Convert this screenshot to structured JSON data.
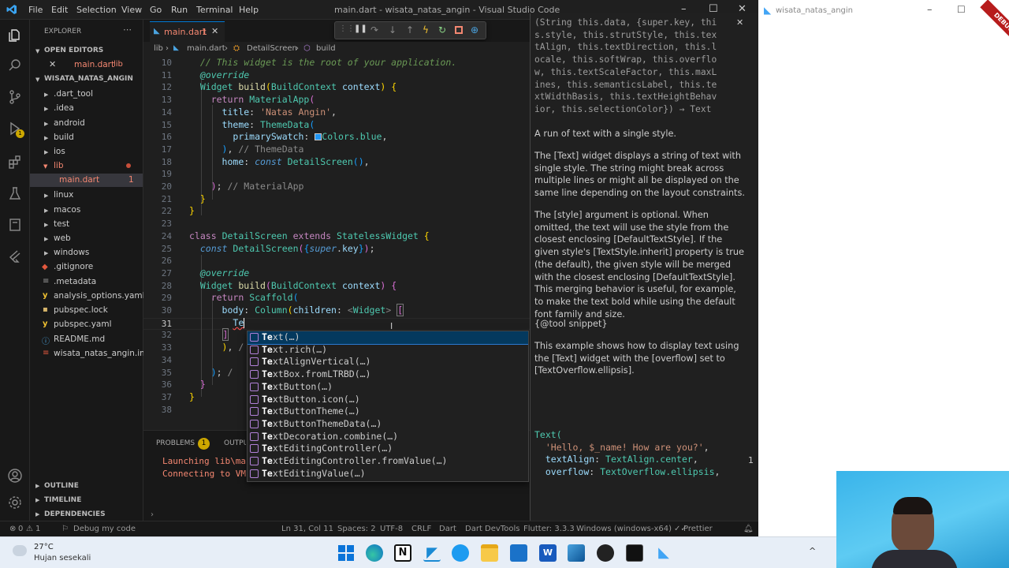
{
  "window": {
    "title": "main.dart - wisata_natas_angin - Visual Studio Code"
  },
  "menu": [
    "File",
    "Edit",
    "Selection",
    "View",
    "Go",
    "Run",
    "Terminal",
    "Help"
  ],
  "tab": {
    "label": "main.dart",
    "badge": "1"
  },
  "breadcrumb": [
    "lib",
    "main.dart",
    "DetailScreen",
    "build"
  ],
  "explorer": {
    "title": "EXPLORER",
    "open_editors_title": "OPEN EDITORS",
    "open_editor": {
      "name": "main.dart",
      "path": "lib"
    },
    "project": "WISATA_NATAS_ANGIN",
    "items": [
      {
        "name": ".dart_tool",
        "type": "folder"
      },
      {
        "name": ".idea",
        "type": "folder"
      },
      {
        "name": "android",
        "type": "folder"
      },
      {
        "name": "build",
        "type": "folder"
      },
      {
        "name": "ios",
        "type": "folder"
      },
      {
        "name": "lib",
        "type": "folder-open"
      },
      {
        "name": "main.dart",
        "type": "file",
        "badge": "1"
      },
      {
        "name": "linux",
        "type": "folder"
      },
      {
        "name": "macos",
        "type": "folder"
      },
      {
        "name": "test",
        "type": "folder"
      },
      {
        "name": "web",
        "type": "folder"
      },
      {
        "name": "windows",
        "type": "folder"
      },
      {
        "name": ".gitignore",
        "type": "file"
      },
      {
        "name": ".metadata",
        "type": "file"
      },
      {
        "name": "analysis_options.yaml",
        "type": "file"
      },
      {
        "name": "pubspec.lock",
        "type": "file"
      },
      {
        "name": "pubspec.yaml",
        "type": "file"
      },
      {
        "name": "README.md",
        "type": "file"
      },
      {
        "name": "wisata_natas_angin.iml",
        "type": "file"
      }
    ],
    "outline": "OUTLINE",
    "timeline": "TIMELINE",
    "dependencies": "DEPENDENCIES"
  },
  "line_numbers": [
    "10",
    "11",
    "12",
    "13",
    "14",
    "15",
    "16",
    "17",
    "18",
    "19",
    "20",
    "21",
    "22",
    "23",
    "24",
    "25",
    "26",
    "27",
    "28",
    "29",
    "30",
    "31",
    "32",
    "33",
    "34",
    "35",
    "36",
    "37",
    "38"
  ],
  "code_text": {
    "l10": "// This widget is the root of your application.",
    "l11": "@override",
    "l13": "'Natas Angin'",
    "l16": "Colors.blue",
    "l17": "// ThemeData",
    "l20": "// MaterialApp",
    "l31": "Te"
  },
  "suggestions": [
    "Text(…)",
    "Text.rich(…)",
    "TextAlignVertical(…)",
    "TextBox.fromLTRBD(…)",
    "TextButton(…)",
    "TextButton.icon(…)",
    "TextButtonTheme(…)",
    "TextButtonThemeData(…)",
    "TextDecoration.combine(…)",
    "TextEditingController(…)",
    "TextEditingController.fromValue(…)",
    "TextEditingValue(…)"
  ],
  "docs": {
    "signature": [
      "(String this.data, {super.key, thi",
      "s.style, this.strutStyle, this.tex",
      "tAlign, this.textDirection, this.l",
      "ocale, this.softWrap, this.overflo",
      "w, this.textScaleFactor, this.maxL",
      "ines, this.semanticsLabel, this.te",
      "xtWidthBasis, this.textHeightBehav",
      "ior, this.selectionColor}) → Text"
    ],
    "p1": "A run of text with a single style.",
    "p2": "The [Text] widget displays a string of text with single style. The string might break across multiple lines or might all be displayed on the same line depending on the layout constraints.",
    "p3": "The [style] argument is optional. When omitted, the text will use the style from the closest enclosing [DefaultTextStyle]. If the given style's [TextStyle.inherit] property is true (the default), the given style will be merged with the closest enclosing [DefaultTextStyle]. This merging behavior is useful, for example, to make the text bold while using the default font family and size.",
    "p4": "{@tool snippet}",
    "p5": "This example shows how to display text using the [Text] widget with the [overflow] set to [TextOverflow.ellipsis].",
    "c1": "Text(",
    "c2": "'Hello, $_name! How are you?'",
    "c3": "TextAlign.center",
    "c4": "TextOverflow.ellipsis",
    "marker": "1"
  },
  "panel": {
    "problems": "PROBLEMS",
    "problems_count": "1",
    "output": "OUTPUT",
    "line1": "Launching lib\\main.dart",
    "line2": "Connecting to VM"
  },
  "status": {
    "errors": "1",
    "warnings": "0",
    "debug": "Debug my code",
    "position": "Ln 31, Col 11",
    "spaces": "Spaces: 2",
    "encoding": "UTF-8",
    "eol": "CRLF",
    "lang": "Dart",
    "devtools": "Dart DevTools",
    "flutter": "Flutter: 3.3.3",
    "device": "Windows (windows-x64)",
    "prettier": "Prettier"
  },
  "app2": {
    "title": "wisata_natas_angin",
    "debug_banner": "DEBUG"
  },
  "weather": {
    "temp": "27°C",
    "desc": "Hujan sesekali"
  },
  "colors": {
    "accent": "#0078d4",
    "suggest_sel": "#04395e",
    "badge": "#cca700",
    "taskbar": "#e7eef7"
  }
}
